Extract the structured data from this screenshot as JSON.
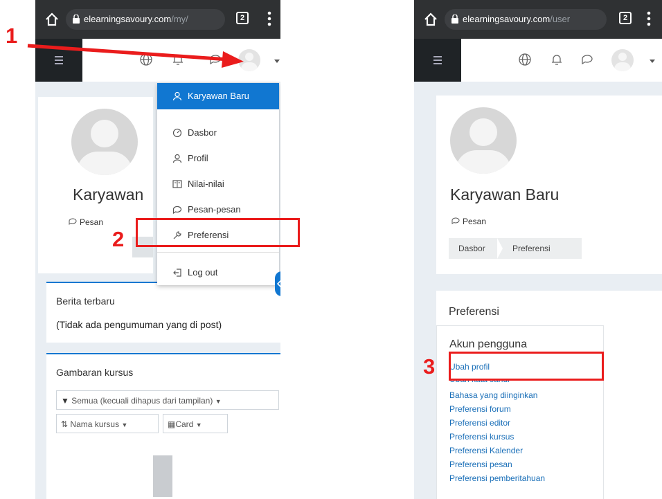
{
  "left_phone": {
    "url_main": "elearningsavoury.com",
    "url_dim": "/my/",
    "tab_count": "2",
    "dropdown": {
      "user_name": "Karyawan Baru",
      "items": [
        {
          "label": "Dasbor",
          "icon": "dashboard-icon"
        },
        {
          "label": "Profil",
          "icon": "user-icon"
        },
        {
          "label": "Nilai-nilai",
          "icon": "grades-icon"
        },
        {
          "label": "Pesan-pesan",
          "icon": "chat-icon"
        },
        {
          "label": "Preferensi",
          "icon": "wrench-icon"
        },
        {
          "label": "Log out",
          "icon": "logout-icon"
        }
      ]
    },
    "profile_name": "Karyawan",
    "message_link": "Pesan",
    "news_title": "Berita terbaru",
    "news_empty": "(Tidak ada pengumuman yang di post)",
    "courses_title": "Gambaran kursus",
    "filter_select": "Semua (kecuali dihapus dari tampilan)",
    "sort_select": "Nama kursus",
    "view_select": "Card"
  },
  "right_phone": {
    "url_main": "elearningsavoury.com",
    "url_dim": "/user",
    "tab_count": "2",
    "profile_name": "Karyawan Baru",
    "message_link": "Pesan",
    "breadcrumb": [
      "Dasbor",
      "Preferensi"
    ],
    "pref_heading": "Preferensi",
    "account_heading": "Akun pengguna",
    "links": [
      "Ubah profil",
      "Ubah kata sandi",
      "Bahasa yang diinginkan",
      "Preferensi forum",
      "Preferensi editor",
      "Preferensi kursus",
      "Preferensi Kalender",
      "Preferensi pesan",
      "Preferensi pemberitahuan"
    ]
  },
  "callouts": [
    "1",
    "2",
    "3"
  ],
  "colors": {
    "accent": "#1177d1",
    "annotation": "#ea1c1c",
    "chrome": "#2f3133"
  }
}
